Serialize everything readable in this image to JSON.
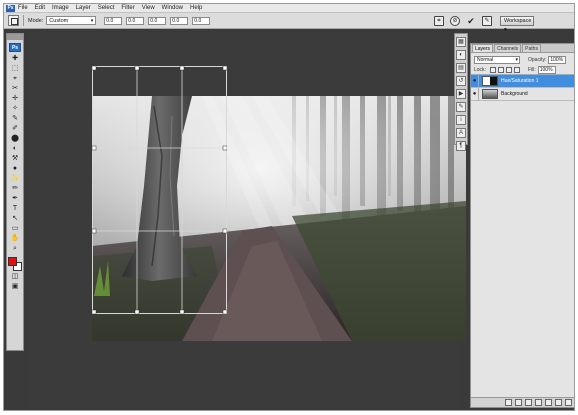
{
  "app": {
    "badge": "Ps"
  },
  "menu": {
    "items": [
      "File",
      "Edit",
      "Image",
      "Layer",
      "Select",
      "Filter",
      "View",
      "Window",
      "Help"
    ]
  },
  "options": {
    "style_label": "Mode:",
    "style_value": "Custom",
    "fields": [
      "0.0",
      "0.0",
      "0.0",
      "0.0",
      "0.0"
    ],
    "workspace_label": "Workspace ▾"
  },
  "tools": [
    "✚",
    "⬚",
    "⌖",
    "✂",
    "✛",
    "✧",
    "✎",
    "✐",
    "⬤",
    "◐",
    "⚒",
    "●",
    "✨",
    "✏",
    "✒",
    "T",
    "↖",
    "▭",
    "✋",
    "⌕"
  ],
  "layers_panel": {
    "tabs": [
      "Layers",
      "Channels",
      "Paths"
    ],
    "blend_mode": "Normal",
    "opacity_label": "Opacity:",
    "opacity_value": "100%",
    "lock_label": "Lock:",
    "fill_label": "Fill:",
    "fill_value": "100%",
    "layers": [
      {
        "name": "Hue/Saturation 1",
        "selected": true
      },
      {
        "name": "Background",
        "selected": false
      }
    ]
  },
  "colors": {
    "foreground": "#e01010",
    "background": "#ffffff",
    "selection": "#3f8ee0"
  }
}
